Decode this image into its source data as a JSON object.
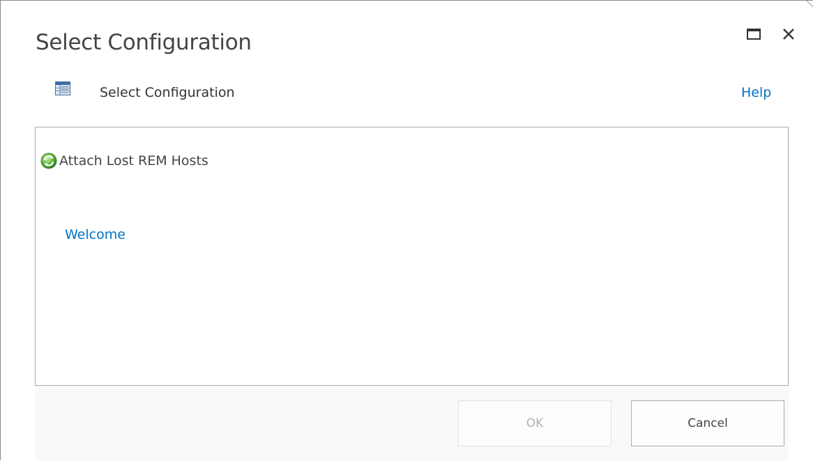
{
  "dialog": {
    "title": "Select Configuration"
  },
  "title_bar": {
    "maximize_icon": "maximize-icon",
    "close_icon": "close-icon",
    "close_glyph": "✕"
  },
  "header": {
    "icon": "table-icon",
    "label": "Select Configuration",
    "help_label": "Help"
  },
  "tree": {
    "root": {
      "icon": "refresh-icon",
      "label": "Attach Lost REM Hosts"
    },
    "welcome_label": "Welcome"
  },
  "footer": {
    "ok_label": "OK",
    "cancel_label": "Cancel",
    "ok_enabled": false
  },
  "colors": {
    "link": "#0072c6",
    "title_text": "#444444",
    "border": "#ababab",
    "footer_bg": "#f9f9f9",
    "disabled_text": "#b1b1b1"
  }
}
